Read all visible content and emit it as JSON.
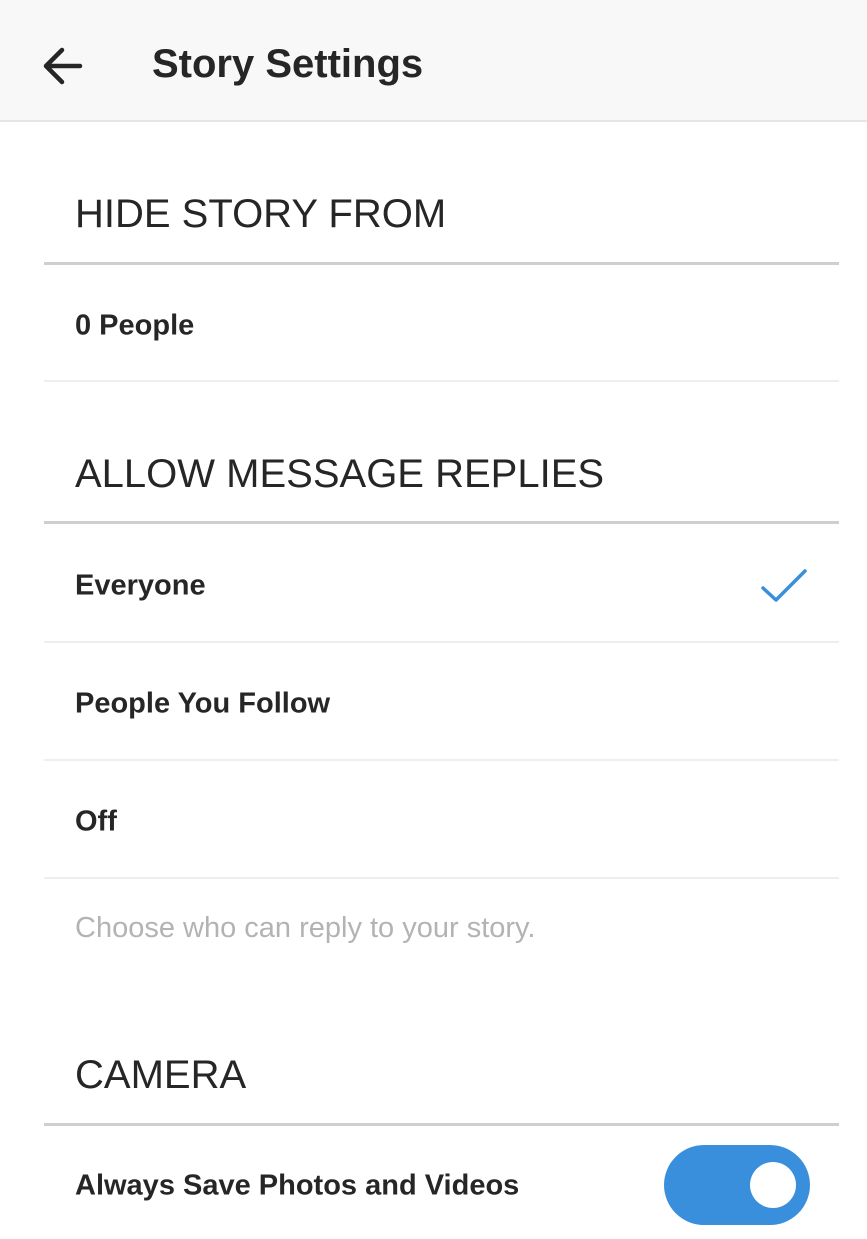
{
  "header": {
    "title": "Story Settings",
    "back_icon": "arrow-left-icon"
  },
  "hide_story": {
    "heading": "HIDE STORY FROM",
    "people_label": "0 People"
  },
  "message_replies": {
    "heading": "ALLOW MESSAGE REPLIES",
    "options": [
      {
        "label": "Everyone",
        "selected": true
      },
      {
        "label": "People You Follow",
        "selected": false
      },
      {
        "label": "Off",
        "selected": false
      }
    ],
    "hint": "Choose who can reply to your story."
  },
  "camera": {
    "heading": "CAMERA",
    "save_label": "Always Save Photos and Videos",
    "save_enabled": true
  },
  "colors": {
    "accent": "#3a8fdc",
    "text": "#262626",
    "hint": "#b3b3b3"
  }
}
